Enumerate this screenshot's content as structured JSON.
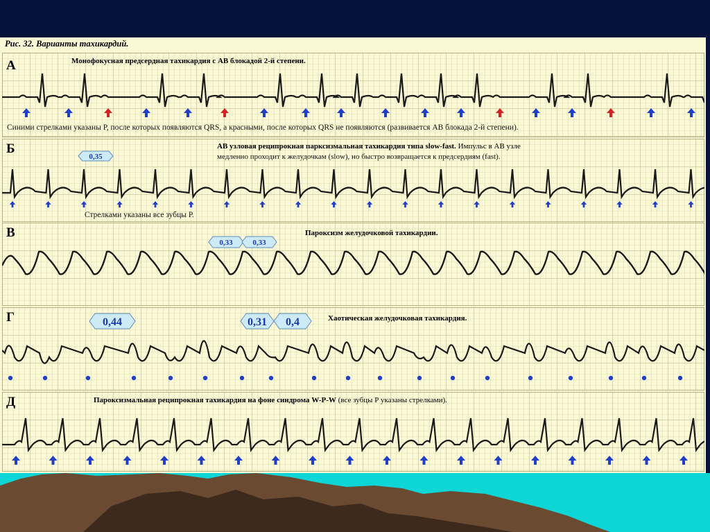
{
  "figure_caption": "Рис. 32. Варианты тахикардий.",
  "strips": [
    {
      "letter": "А",
      "title": "Монофокусная предсердная тахикардия с АВ блокадой 2-й степени.",
      "note": "Синими стрелками указаны Р, после которых появляются QRS, а красными, после которых QRS не появляются (развивается АВ блокада 2-й степени)."
    },
    {
      "letter": "Б",
      "title": "АВ узловая реципрокная парксизмальная тахикардия типа slow-fast.",
      "title_tail": " Импульс в АВ узле",
      "title_line2": "медленно проходит к желудочкам (slow), но быстро возвращается к предсердиям (fast).",
      "note": "Стрелками указаны все зубцы Р.",
      "intervals": [
        "0,35"
      ]
    },
    {
      "letter": "В",
      "title": "Пароксизм желудочковой тахикардии.",
      "intervals": [
        "0,33",
        "0,33"
      ]
    },
    {
      "letter": "Г",
      "title": "Хаотическая желудочковая тахикардия.",
      "intervals": [
        "0,44",
        "0,31",
        "0,4"
      ]
    },
    {
      "letter": "Д",
      "title": "Пароксизмальная реципрокная тахикардия на фоне синдрома W-P-W",
      "title_tail": " (все зубцы Р указаны стрелками)."
    }
  ],
  "chart_data": [
    {
      "type": "ecg-strip",
      "strip": "А",
      "p_wave_markers": [
        {
          "index": 1,
          "color": "blue"
        },
        {
          "index": 2,
          "color": "blue"
        },
        {
          "index": 3,
          "color": "red"
        },
        {
          "index": 4,
          "color": "blue"
        },
        {
          "index": 5,
          "color": "blue"
        },
        {
          "index": 6,
          "color": "red"
        },
        {
          "index": 7,
          "color": "blue"
        },
        {
          "index": 8,
          "color": "blue"
        },
        {
          "index": 9,
          "color": "blue"
        },
        {
          "index": 10,
          "color": "blue"
        },
        {
          "index": 11,
          "color": "blue"
        },
        {
          "index": 12,
          "color": "blue"
        },
        {
          "index": 13,
          "color": "red"
        },
        {
          "index": 14,
          "color": "blue"
        },
        {
          "index": 15,
          "color": "blue"
        },
        {
          "index": 16,
          "color": "red"
        },
        {
          "index": 17,
          "color": "blue"
        },
        {
          "index": 18,
          "color": "blue"
        }
      ]
    },
    {
      "type": "ecg-strip",
      "strip": "Б",
      "p_wave_markers": 20,
      "marker_color": "blue",
      "interval_labels": [
        "0,35"
      ]
    },
    {
      "type": "ecg-strip",
      "strip": "В",
      "interval_labels": [
        "0,33",
        "0,33"
      ]
    },
    {
      "type": "ecg-strip",
      "strip": "Г",
      "dot_markers": 19,
      "interval_labels": [
        "0,44",
        "0,31",
        "0,4"
      ]
    },
    {
      "type": "ecg-strip",
      "strip": "Д",
      "p_wave_markers": 19,
      "marker_color": "blue"
    }
  ],
  "colors": {
    "paper": "#fbf8d6",
    "grid": "#cbc58e",
    "trace": "#1a1a1a",
    "marker_blue": "#1f3fc9",
    "marker_red": "#d42222",
    "label_fill": "#cdeaf7",
    "label_text": "#1a3aa8"
  }
}
